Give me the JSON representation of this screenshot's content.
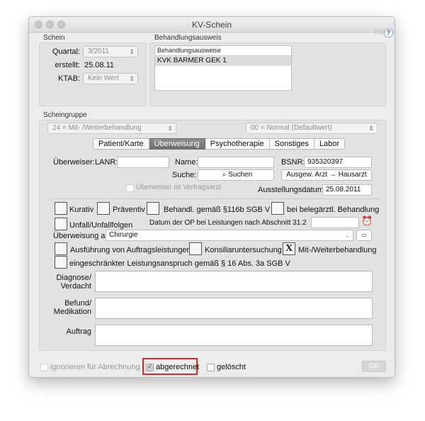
{
  "window": {
    "title": "KV-Schein",
    "version": "192",
    "help_label": "?"
  },
  "schein": {
    "section_label": "Schein",
    "quartal_label": "Quartal:",
    "quartal_value": "3/2011",
    "erstellt_label": "erstellt:",
    "erstellt_value": "25.08.11",
    "ktab_label": "KTAB:",
    "ktab_value": "Kein Wert"
  },
  "behandlungsausweis": {
    "section_label": "Behandlungsausweis",
    "list_header": "Behandlungsausweise",
    "items": [
      "KVK BARMER GEK 1"
    ]
  },
  "scheingruppe": {
    "section_label": "Scheingruppe",
    "group_value": "24 = Mit- /Weiterbehandlung",
    "normal_value": "00 = Normal (Defaultwert)"
  },
  "tabs": [
    {
      "label": "Patient/Karte"
    },
    {
      "label": "Überweisung",
      "active": true
    },
    {
      "label": "Psychotherapie"
    },
    {
      "label": "Sonstiges"
    },
    {
      "label": "Labor"
    }
  ],
  "ueberweisung": {
    "ueberweiser_label": "Überweiser:",
    "lanr_label": "LANR:",
    "lanr_value": "",
    "name_label": "Name:",
    "name_value": "",
    "bsnr_label": "BSNR:",
    "bsnr_value": "935320397",
    "suche_label": "Suche:",
    "suche_placeholder": "Suchen",
    "ausgew_button": "Ausgew. Arzt → Hausarzt",
    "vertragsarzt_label": "Überweiser ist Vertragsarzt",
    "ausstellungsdatum_label": "Ausstellungsdatum:",
    "ausstellungsdatum_value": "25.08.2011",
    "kurativ_label": "Kurativ",
    "praeventiv_label": "Präventiv",
    "behandl_label": "Behandl. gemäß  §116b SGB V",
    "belegaerztl_label": "bei belegärztl. Behandlung",
    "unfall_label": "Unfall/Unfallfolgen",
    "datum_op_label": "Datum der OP bei Leistungen nach Abschnitt 31.2",
    "ueberweisung_an_label": "Überweisung an",
    "ueberweisung_an_value": "Chirurgie",
    "ausfuehrung_label": "Ausführung von Auftragsleistungen",
    "konsiliar_label": "Konsiliaruntersuchung",
    "mitweiter_label": "Mit-/Weiterbehandlung",
    "eingeschraenkt_label": "eingeschränkter Leistungsanspruch gemäß § 16 Abs. 3a SGB V",
    "diagnose_label_1": "Diagnose/",
    "diagnose_label_2": "Verdacht",
    "befund_label_1": "Befund/",
    "befund_label_2": "Medikation",
    "auftrag_label": "Auftrag"
  },
  "footer": {
    "ignorieren_label": "ignorieren für Abrechnung",
    "abgerechnet_label": "abgerechnet",
    "geloescht_label": "gelöscht",
    "ok_label": "OK"
  },
  "colors": {
    "highlight": "#d52b2b",
    "active_tab": "#7a7a7a"
  }
}
